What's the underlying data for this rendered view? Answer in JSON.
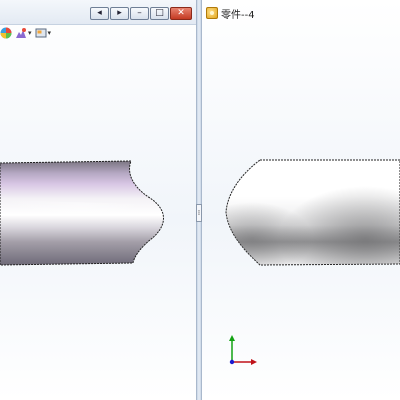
{
  "left_window": {
    "buttons": [
      {
        "name": "prev-window-button",
        "symbol": "◂"
      },
      {
        "name": "next-window-button",
        "symbol": "▸"
      },
      {
        "name": "minimize-button",
        "symbol": "–"
      },
      {
        "name": "restore-button",
        "symbol": "□"
      },
      {
        "name": "close-button",
        "symbol": "✕"
      }
    ],
    "toolbar_icons": [
      "appearance-icon",
      "scene-icon",
      "view-settings-icon"
    ]
  },
  "right_window": {
    "tab_title": "零件--4",
    "tab_icon": "part-document-icon"
  },
  "divider": {
    "handle_symbol": "⁞"
  },
  "triad_axes": [
    "x-axis",
    "y-axis",
    "z-axis"
  ],
  "colors": {
    "part_purple_highlight": "#c9a8d6",
    "part_metal_dark": "#6e6a78",
    "part_metal_light": "#f2f2f4",
    "triad_x": "#c0121a",
    "triad_y": "#13a313",
    "triad_z": "#1a1ad0"
  }
}
